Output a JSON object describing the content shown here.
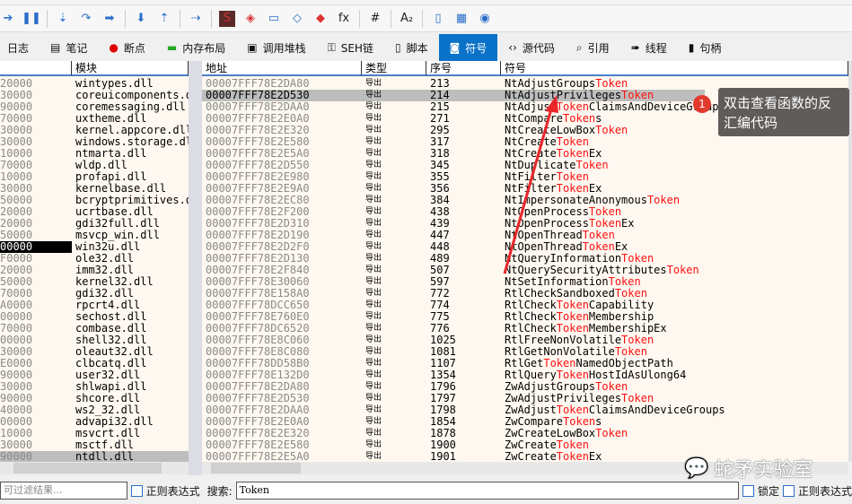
{
  "toolbar": {
    "icons": [
      "run-icon",
      "pause-icon",
      "step-into-icon",
      "step-over-icon",
      "run-to-user-icon",
      "execute-till-return-icon",
      "step-out-icon",
      "trace-icon",
      "script-s-icon",
      "patch-icon",
      "comment-icon",
      "label-icon",
      "bookmark-icon",
      "function-icon",
      "hash-icon",
      "font-icon",
      "device-icon",
      "calculator-icon",
      "globe-icon"
    ]
  },
  "tabs": [
    {
      "label": "日志"
    },
    {
      "label": "笔记"
    },
    {
      "label": "断点"
    },
    {
      "label": "内存布局"
    },
    {
      "label": "调用堆栈"
    },
    {
      "label": "SEH链"
    },
    {
      "label": "脚本"
    },
    {
      "label": "符号",
      "active": true
    },
    {
      "label": "源代码"
    },
    {
      "label": "引用"
    },
    {
      "label": "线程"
    },
    {
      "label": "句柄"
    }
  ],
  "left": {
    "headers": [
      "",
      "模块"
    ],
    "rows": [
      [
        "20000",
        "wintypes.dll"
      ],
      [
        "30000",
        "coreuicomponents.dll"
      ],
      [
        "90000",
        "coremessaging.dll"
      ],
      [
        "70000",
        "uxtheme.dll"
      ],
      [
        "30000",
        "kernel.appcore.dll"
      ],
      [
        "30000",
        "windows.storage.dll"
      ],
      [
        "10000",
        "ntmarta.dll"
      ],
      [
        "70000",
        "wldp.dll"
      ],
      [
        "10000",
        "profapi.dll"
      ],
      [
        "30000",
        "kernelbase.dll"
      ],
      [
        "50000",
        "bcryptprimitives.dll"
      ],
      [
        "20000",
        "ucrtbase.dll"
      ],
      [
        "20000",
        "gdi32full.dll"
      ],
      [
        "50000",
        "msvcp_win.dll"
      ],
      [
        "00000",
        "win32u.dll"
      ],
      [
        "F0000",
        "ole32.dll"
      ],
      [
        "20000",
        "imm32.dll"
      ],
      [
        "50000",
        "kernel32.dll"
      ],
      [
        "70000",
        "gdi32.dll"
      ],
      [
        "A0000",
        "rpcrt4.dll"
      ],
      [
        "00000",
        "sechost.dll"
      ],
      [
        "70000",
        "combase.dll"
      ],
      [
        "00000",
        "shell32.dll"
      ],
      [
        "30000",
        "oleaut32.dll"
      ],
      [
        "E0000",
        "clbcatq.dll"
      ],
      [
        "90000",
        "user32.dll"
      ],
      [
        "30000",
        "shlwapi.dll"
      ],
      [
        "90000",
        "shcore.dll"
      ],
      [
        "40000",
        "ws2_32.dll"
      ],
      [
        "00000",
        "advapi32.dll"
      ],
      [
        "10000",
        "msvcrt.dll"
      ],
      [
        "30000",
        "msctf.dll"
      ],
      [
        "90000",
        "ntdll.dll"
      ]
    ],
    "black_row": 14,
    "selected_row": 32
  },
  "right": {
    "headers": [
      "地址",
      "类型",
      "序号",
      "符号"
    ],
    "type_value": "导出",
    "highlight": "Token",
    "selected_row": 1,
    "rows": [
      [
        "00007FFF78E2DA80",
        "213",
        "NtAdjustGroups",
        "Token",
        ""
      ],
      [
        "00007FFF78E2D530",
        "214",
        "NtAdjustPrivileges",
        "Token",
        ""
      ],
      [
        "00007FFF78E2DAA0",
        "215",
        "NtAdjust",
        "Token",
        "ClaimsAndDeviceGroups"
      ],
      [
        "00007FFF78E2E0A0",
        "271",
        "NtCompare",
        "Token",
        "s"
      ],
      [
        "00007FFF78E2E320",
        "295",
        "NtCreateLowBox",
        "Token",
        ""
      ],
      [
        "00007FFF78E2E580",
        "317",
        "NtCreate",
        "Token",
        ""
      ],
      [
        "00007FFF78E2E5A0",
        "318",
        "NtCreate",
        "Token",
        "Ex"
      ],
      [
        "00007FFF78E2D550",
        "345",
        "NtDuplicate",
        "Token",
        ""
      ],
      [
        "00007FFF78E2E980",
        "355",
        "NtFilter",
        "Token",
        ""
      ],
      [
        "00007FFF78E2E9A0",
        "356",
        "NtFilter",
        "Token",
        "Ex"
      ],
      [
        "00007FFF78E2EC80",
        "384",
        "NtImpersonateAnonymous",
        "Token",
        ""
      ],
      [
        "00007FFF78E2F200",
        "438",
        "NtOpenProcess",
        "Token",
        ""
      ],
      [
        "00007FFF78E2D310",
        "439",
        "NtOpenProcess",
        "Token",
        "Ex"
      ],
      [
        "00007FFF78E2D190",
        "447",
        "NtOpenThread",
        "Token",
        ""
      ],
      [
        "00007FFF78E2D2F0",
        "448",
        "NtOpenThread",
        "Token",
        "Ex"
      ],
      [
        "00007FFF78E2D130",
        "489",
        "NtQueryInformation",
        "Token",
        ""
      ],
      [
        "00007FFF78E2F840",
        "507",
        "NtQuerySecurityAttributes",
        "Token",
        ""
      ],
      [
        "00007FFF78E30060",
        "597",
        "NtSetInformation",
        "Token",
        ""
      ],
      [
        "00007FFF78E158A0",
        "772",
        "RtlCheckSandboxed",
        "Token",
        ""
      ],
      [
        "00007FFF78DCC650",
        "774",
        "RtlCheck",
        "Token",
        "Capability"
      ],
      [
        "00007FFF78E760E0",
        "775",
        "RtlCheck",
        "Token",
        "Membership"
      ],
      [
        "00007FFF78DC6520",
        "776",
        "RtlCheck",
        "Token",
        "MembershipEx"
      ],
      [
        "00007FFF78E8C060",
        "1025",
        "RtlFreeNonVolatile",
        "Token",
        ""
      ],
      [
        "00007FFF78E8C080",
        "1081",
        "RtlGetNonVolatile",
        "Token",
        ""
      ],
      [
        "00007FFF78DD58B0",
        "1107",
        "RtlGet",
        "Token",
        "NamedObjectPath"
      ],
      [
        "00007FFF78E132D0",
        "1354",
        "RtlQuery",
        "Token",
        "HostIdAsUlong64"
      ],
      [
        "00007FFF78E2DA80",
        "1796",
        "ZwAdjustGroups",
        "Token",
        ""
      ],
      [
        "00007FFF78E2D530",
        "1797",
        "ZwAdjustPrivileges",
        "Token",
        ""
      ],
      [
        "00007FFF78E2DAA0",
        "1798",
        "ZwAdjust",
        "Token",
        "ClaimsAndDeviceGroups"
      ],
      [
        "00007FFF78E2E0A0",
        "1854",
        "ZwCompare",
        "Token",
        "s"
      ],
      [
        "00007FFF78E2E320",
        "1878",
        "ZwCreateLowBox",
        "Token",
        ""
      ],
      [
        "00007FFF78E2E580",
        "1900",
        "ZwCreate",
        "Token",
        ""
      ],
      [
        "00007FFF78E2E5A0",
        "1901",
        "ZwCreate",
        "Token",
        "Ex"
      ]
    ]
  },
  "bottom": {
    "filter_placeholder": "可过滤结果...",
    "regex_label": "正则表达式",
    "search_label": "搜索:",
    "search_value": "Token",
    "lock_label": "锁定",
    "regex_label2": "正则表达式"
  },
  "annotation": {
    "badge": "1",
    "text": "双击查看函数的反汇编代码"
  },
  "watermark": "蛇矛实验室"
}
